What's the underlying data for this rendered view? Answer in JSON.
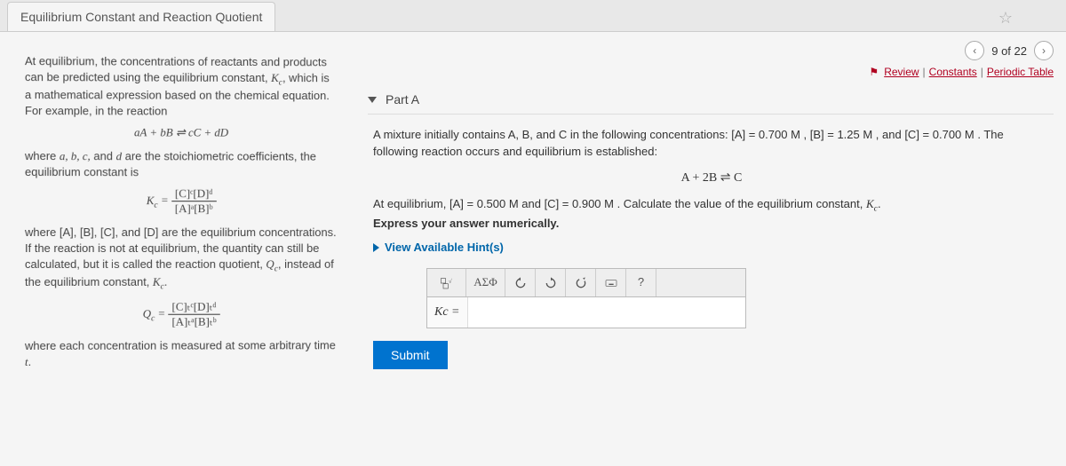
{
  "tab": {
    "title": "Equilibrium Constant and Reaction Quotient"
  },
  "nav": {
    "position": "9 of 22"
  },
  "links": {
    "review": "Review",
    "constants": "Constants",
    "periodic": "Periodic Table"
  },
  "left": {
    "p1a": "At equilibrium, the concentrations of reactants and products can be predicted using the equilibrium constant, ",
    "p1b": ", which is a mathematical expression based on the chemical equation. For example, in the reaction",
    "eq1": "aA + bB ⇌ cC + dD",
    "p2a": "where ",
    "p2b": " are the stoichiometric coefficients, the equilibrium constant is",
    "kc_label": "K",
    "kc_sub": "c",
    "frac1_top": "[C]ᶜ[D]ᵈ",
    "frac1_bot": "[A]ᵃ[B]ᵇ",
    "p3a": "where [A], [B], [C], and [D] are the equilibrium concentrations. If the reaction is not at equilibrium, the quantity can still be calculated, but it is called the reaction quotient, ",
    "p3b": ", instead of the equilibrium constant, ",
    "qc_label": "Q",
    "frac2_top": "[C]ₜᶜ[D]ₜᵈ",
    "frac2_bot": "[A]ₜᵃ[B]ₜᵇ",
    "p4": "where each concentration is measured at some arbitrary time ",
    "p4_t": "t"
  },
  "part": {
    "header": "Part A",
    "q1": "A mixture initially contains A, B, and C in the following concentrations: [A] = 0.700 M , [B] = 1.25 M , and [C] = 0.700 M . The following reaction occurs and equilibrium is established:",
    "reaction": "A + 2B ⇌ C",
    "q2": "At equilibrium, [A] = 0.500 M and [C] = 0.900 M . Calculate the value of the equilibrium constant, ",
    "q2_end": ".",
    "instr": "Express your answer numerically.",
    "hint": "View Available Hint(s)",
    "prefix": "Kc =",
    "submit": "Submit"
  },
  "tools": {
    "templates": "⎕√",
    "greek": "ΑΣΦ",
    "help": "?"
  }
}
